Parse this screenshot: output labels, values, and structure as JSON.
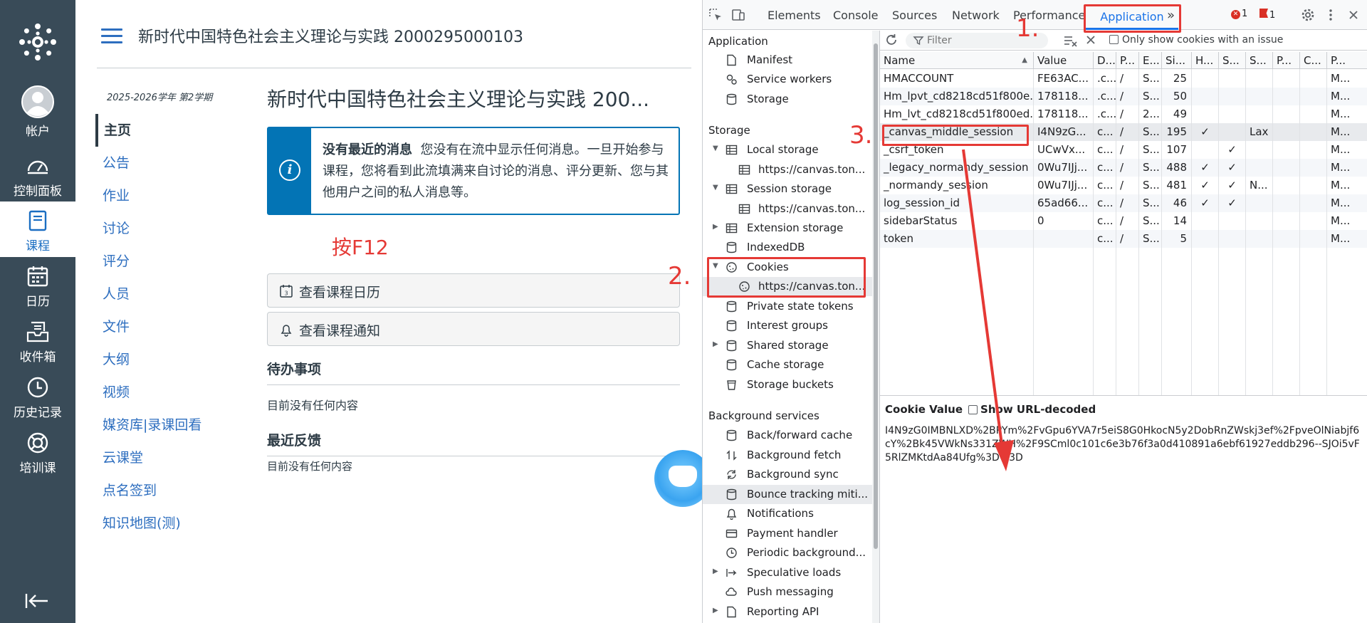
{
  "global_nav": {
    "items": [
      {
        "key": "account",
        "label": "帐户",
        "icon": "avatar-icon"
      },
      {
        "key": "dashboard",
        "label": "控制面板",
        "icon": "dashboard-icon"
      },
      {
        "key": "courses",
        "label": "课程",
        "icon": "book-icon",
        "active": true
      },
      {
        "key": "calendar",
        "label": "日历",
        "icon": "calendar-icon"
      },
      {
        "key": "inbox",
        "label": "收件箱",
        "icon": "inbox-icon"
      },
      {
        "key": "history",
        "label": "历史记录",
        "icon": "clock-icon"
      },
      {
        "key": "training",
        "label": "培训课",
        "icon": "lifebuoy-icon"
      }
    ]
  },
  "header": {
    "breadcrumb": "新时代中国特色社会主义理论与实践 2000295000103"
  },
  "course_nav": {
    "term": "2025-2026学年 第2学期",
    "items": [
      "主页",
      "公告",
      "作业",
      "讨论",
      "评分",
      "人员",
      "文件",
      "大纲",
      "视频",
      "媒资库|录课回看",
      "云课堂",
      "点名签到",
      "知识地图(测)"
    ]
  },
  "main": {
    "course_title": "新时代中国特色社会主义理论与实践 200...",
    "alert_bold": "没有最近的消息",
    "alert_text": "您没有在流中显示任何消息。一旦开始参与课程，您将看到此流填满来自讨论的消息、评分更新、您与其他用户之间的私人消息等。",
    "annotation_f12": "按F12",
    "btn_calendar": "查看课程日历",
    "btn_notifications": "查看课程通知",
    "todo_heading": "待办事项",
    "todo_empty": "目前没有任何内容",
    "feedback_heading": "最近反馈",
    "feedback_empty": "目前没有任何内容"
  },
  "devtools": {
    "tabs": [
      "Elements",
      "Console",
      "Sources",
      "Network",
      "Performance"
    ],
    "active_tab": "Application",
    "more_tabs": "»",
    "errors_count": "1",
    "issues_count": "1",
    "tree": {
      "application_heading": "Application",
      "application_items": [
        "Manifest",
        "Service workers",
        "Storage"
      ],
      "storage_heading": "Storage",
      "storage_items": {
        "local_storage": "Local storage",
        "local_origin": "https://canvas.ton...",
        "session_storage": "Session storage",
        "session_origin": "https://canvas.ton...",
        "extension_storage": "Extension storage",
        "indexeddb": "IndexedDB",
        "cookies": "Cookies",
        "cookies_origin": "https://canvas.ton...",
        "private_state": "Private state tokens",
        "interest_groups": "Interest groups",
        "shared_storage": "Shared storage",
        "cache_storage": "Cache storage",
        "storage_buckets": "Storage buckets"
      },
      "bg_heading": "Background services",
      "bg_items": [
        "Back/forward cache",
        "Background fetch",
        "Background sync",
        "Bounce tracking miti...",
        "Notifications",
        "Payment handler",
        "Periodic background...",
        "Speculative loads",
        "Push messaging",
        "Reporting API"
      ]
    },
    "cookies": {
      "filter_placeholder": "Filter",
      "only_issue_label": "Only show cookies with an issue",
      "columns": [
        "Name",
        "Value",
        "D...",
        "P...",
        "E...",
        "Si...",
        "H...",
        "S...",
        "S...",
        "P...",
        "C...",
        "P..."
      ],
      "sort_indicator": "▲",
      "rows": [
        [
          "HMACCOUNT",
          "FE63AC...",
          ".c...",
          "/",
          "S...",
          "25",
          "",
          "",
          "",
          "",
          "",
          "M..."
        ],
        [
          "Hm_lpvt_cd8218cd51f800e...",
          "178118...",
          ".c...",
          "/",
          "S...",
          "50",
          "",
          "",
          "",
          "",
          "",
          "M..."
        ],
        [
          "Hm_lvt_cd8218cd51f800ed...",
          "178118...",
          ".c...",
          "/",
          "2...",
          "49",
          "",
          "",
          "",
          "",
          "",
          "M..."
        ],
        [
          "_canvas_middle_session",
          "I4N9zG...",
          "c...",
          "/",
          "S...",
          "195",
          "✓",
          "",
          "Lax",
          "",
          "",
          "M..."
        ],
        [
          "_csrf_token",
          "UCwVx...",
          "c...",
          "/",
          "S...",
          "107",
          "",
          "✓",
          "",
          "",
          "",
          "M..."
        ],
        [
          "_legacy_normandy_session",
          "0Wu7IJj...",
          "c...",
          "/",
          "S...",
          "488",
          "✓",
          "✓",
          "",
          "",
          "",
          "M..."
        ],
        [
          "_normandy_session",
          "0Wu7IJj...",
          "c...",
          "/",
          "S...",
          "481",
          "✓",
          "✓",
          "N...",
          "",
          "",
          "M..."
        ],
        [
          "log_session_id",
          "65ad66...",
          "c...",
          "/",
          "S...",
          "46",
          "✓",
          "✓",
          "",
          "",
          "",
          "M..."
        ],
        [
          "sidebarStatus",
          "0",
          "c...",
          "/",
          "S...",
          "14",
          "",
          "",
          "",
          "",
          "",
          "M..."
        ],
        [
          "token",
          "",
          "c...",
          "/",
          "S...",
          "5",
          "",
          "",
          "",
          "",
          "",
          "M..."
        ]
      ],
      "selected_row": 3,
      "cookie_value_label": "Cookie Value",
      "show_decoded_label": "Show URL-decoded",
      "cookie_value": "I4N9zG0IMBNLXD%2BPYm%2FvGpu6YVA7r5eiS8G0HkocN5y2DobRnZWskj3ef%2FpveOlNiabjf6cY%2Bk45VWkNs331ZWH%2F9SCml0c101c6e3b76f3a0d410891a6ebf61927eddb296--SJOi5vF5RlZMKtdAa84Ufg%3D%3D"
    }
  },
  "annotations": {
    "step1": "1.",
    "step2": "2.",
    "step3": "3.",
    "color": "#e53935"
  }
}
